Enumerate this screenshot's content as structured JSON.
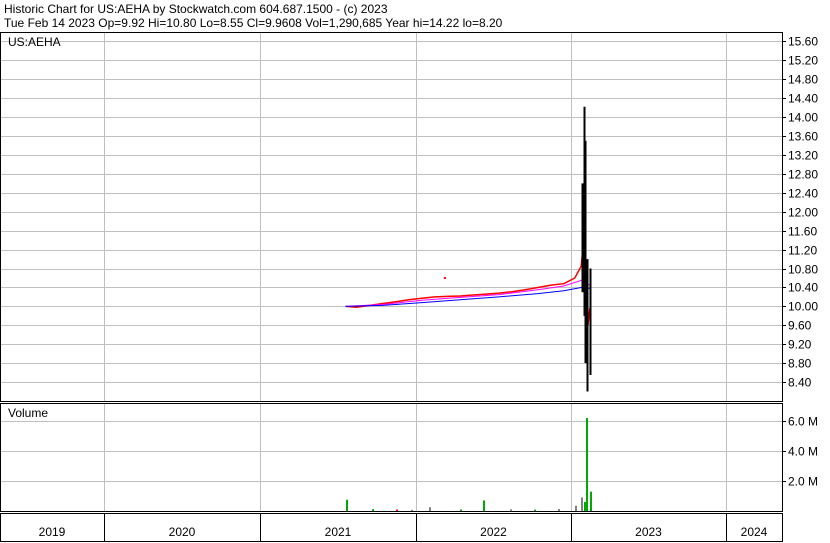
{
  "header": {
    "line1": "Historic Chart for US:AEHA by Stockwatch.com 604.687.1500 - (c) 2023",
    "line2": "Tue Feb 14 2023   Op=9.92   Hi=10.80   Lo=8.55   Cl=9.9608   Vol=1,290,685   Year hi=14.22   lo=8.20"
  },
  "chart_data": [
    {
      "type": "line",
      "title": "US:AEHA",
      "ylim": [
        8.0,
        15.8
      ],
      "yticks": [
        8.4,
        8.8,
        9.2,
        9.6,
        10.0,
        10.4,
        10.8,
        11.2,
        11.6,
        12.0,
        12.4,
        12.8,
        13.2,
        13.6,
        14.0,
        14.4,
        14.8,
        15.2,
        15.6
      ],
      "ytick_labels": [
        "8.40",
        "8.80",
        "9.20",
        "9.60",
        "10.00",
        "10.40",
        "10.80",
        "11.20",
        "11.60",
        "12.00",
        "12.40",
        "12.80",
        "13.20",
        "13.60",
        "14.00",
        "14.40",
        "14.80",
        "15.20",
        "15.60"
      ],
      "x_year_labels": [
        "2019",
        "2020",
        "2021",
        "2022",
        "2023",
        "2024"
      ],
      "grid": true,
      "series": [
        {
          "role": "close",
          "color": "#ff0000",
          "points": [
            [
              "2021-07-20",
              10.0
            ],
            [
              "2021-08-15",
              9.98
            ],
            [
              "2021-09-15",
              10.02
            ],
            [
              "2021-10-15",
              10.06
            ],
            [
              "2021-11-15",
              10.1
            ],
            [
              "2021-12-15",
              10.14
            ],
            [
              "2022-01-15",
              10.17
            ],
            [
              "2022-02-15",
              10.2
            ],
            [
              "2022-03-15",
              10.21
            ],
            [
              "2022-04-15",
              10.22
            ],
            [
              "2022-05-15",
              10.24
            ],
            [
              "2022-06-15",
              10.26
            ],
            [
              "2022-07-15",
              10.28
            ],
            [
              "2022-08-15",
              10.31
            ],
            [
              "2022-09-15",
              10.35
            ],
            [
              "2022-10-15",
              10.4
            ],
            [
              "2022-11-15",
              10.45
            ],
            [
              "2022-12-15",
              10.48
            ],
            [
              "2023-01-10",
              10.6
            ],
            [
              "2023-01-25",
              10.85
            ],
            [
              "2023-02-02",
              11.6
            ],
            [
              "2023-02-06",
              10.2
            ],
            [
              "2023-02-10",
              9.6
            ],
            [
              "2023-02-14",
              9.96
            ]
          ]
        },
        {
          "role": "ma1",
          "color": "#ff00ff",
          "points": [
            [
              "2021-07-20",
              10.0
            ],
            [
              "2021-10-15",
              10.04
            ],
            [
              "2022-01-15",
              10.13
            ],
            [
              "2022-04-15",
              10.19
            ],
            [
              "2022-07-15",
              10.25
            ],
            [
              "2022-10-15",
              10.35
            ],
            [
              "2022-12-15",
              10.43
            ],
            [
              "2023-01-25",
              10.55
            ],
            [
              "2023-02-14",
              10.45
            ]
          ]
        },
        {
          "role": "ma2",
          "color": "#0000ff",
          "points": [
            [
              "2021-07-20",
              10.0
            ],
            [
              "2021-10-15",
              10.02
            ],
            [
              "2022-01-15",
              10.08
            ],
            [
              "2022-04-15",
              10.14
            ],
            [
              "2022-07-15",
              10.2
            ],
            [
              "2022-10-15",
              10.27
            ],
            [
              "2022-12-15",
              10.33
            ],
            [
              "2023-01-25",
              10.4
            ],
            [
              "2023-02-14",
              10.38
            ]
          ]
        }
      ],
      "ranges": [
        {
          "date": "2023-01-28",
          "low": 10.3,
          "high": 12.6
        },
        {
          "date": "2023-02-01",
          "low": 9.8,
          "high": 14.22
        },
        {
          "date": "2023-02-03",
          "low": 8.8,
          "high": 13.5
        },
        {
          "date": "2023-02-08",
          "low": 8.2,
          "high": 11.0
        },
        {
          "date": "2023-02-14",
          "low": 8.55,
          "high": 10.8
        }
      ],
      "outliers": [
        [
          "2022-03-10",
          10.6
        ]
      ]
    },
    {
      "type": "bar",
      "title": "Volume",
      "ylim": [
        0,
        7200000
      ],
      "yticks": [
        2000000,
        4000000,
        6000000
      ],
      "ytick_labels": [
        "2.0 M",
        "4.0 M",
        "6.0 M"
      ],
      "grid": true,
      "colors": {
        "up": "#00aa00",
        "down": "#ff0000",
        "flat": "#808080"
      },
      "bars": [
        {
          "date": "2021-07-22",
          "value": 750000,
          "dir": "up"
        },
        {
          "date": "2021-09-20",
          "value": 120000,
          "dir": "up"
        },
        {
          "date": "2021-11-15",
          "value": 90000,
          "dir": "down"
        },
        {
          "date": "2021-12-20",
          "value": 80000,
          "dir": "flat"
        },
        {
          "date": "2022-02-01",
          "value": 250000,
          "dir": "flat"
        },
        {
          "date": "2022-04-15",
          "value": 100000,
          "dir": "up"
        },
        {
          "date": "2022-06-07",
          "value": 700000,
          "dir": "up"
        },
        {
          "date": "2022-08-10",
          "value": 110000,
          "dir": "flat"
        },
        {
          "date": "2022-10-05",
          "value": 90000,
          "dir": "up"
        },
        {
          "date": "2022-12-01",
          "value": 130000,
          "dir": "flat"
        },
        {
          "date": "2023-01-10",
          "value": 350000,
          "dir": "flat"
        },
        {
          "date": "2023-01-25",
          "value": 900000,
          "dir": "flat"
        },
        {
          "date": "2023-02-01",
          "value": 600000,
          "dir": "up"
        },
        {
          "date": "2023-02-06",
          "value": 6200000,
          "dir": "up"
        },
        {
          "date": "2023-02-14",
          "value": 1290685,
          "dir": "up"
        }
      ]
    }
  ],
  "colors": {
    "frame": "#000000",
    "grid": "#c0c0c0",
    "wick": "#000000"
  }
}
